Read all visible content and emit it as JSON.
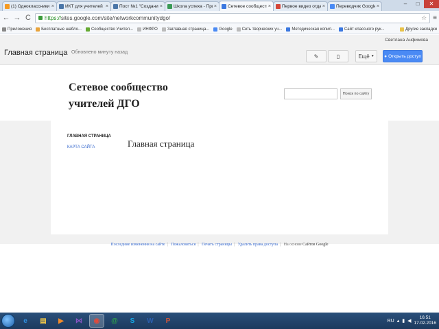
{
  "browser": {
    "tabs": [
      {
        "title": "(1) Одноклассники",
        "icon": "ok-favicon",
        "color": "#f59a23"
      },
      {
        "title": "ИКТ для учителей 2",
        "icon": "vk-favicon",
        "color": "#4a76a8"
      },
      {
        "title": "Пост №1 \"Создание",
        "icon": "vk-favicon",
        "color": "#4a76a8"
      },
      {
        "title": "Школа успеха - Прил",
        "icon": "sites-favicon",
        "color": "#3a9a56"
      },
      {
        "title": "Сетевое сообщество",
        "icon": "sites-favicon",
        "color": "#3b78e0",
        "active": true
      },
      {
        "title": "Первое видео отдания",
        "icon": "gmail-favicon",
        "color": "#d44638"
      },
      {
        "title": "Переводчик Google",
        "icon": "translate-favicon",
        "color": "#4a8af4"
      }
    ],
    "url_scheme": "https://",
    "url_rest": "sites.google.com/site/networkcommunitydgo/",
    "bookmarks": [
      {
        "label": "Приложения",
        "icon": "apps-icon",
        "color": "#888"
      },
      {
        "label": "Бесплатные шабло...",
        "icon": "bookmark-icon",
        "color": "#e8a33b"
      },
      {
        "label": "Сообщество Учител...",
        "icon": "bookmark-icon",
        "color": "#66aa33"
      },
      {
        "label": "ИНФРО",
        "icon": "page-icon",
        "color": "#bbb"
      },
      {
        "label": "Заглавная страница...",
        "icon": "page-icon",
        "color": "#bbb"
      },
      {
        "label": "Google",
        "icon": "google-icon",
        "color": "#4a8af4"
      },
      {
        "label": "Сеть творческих уч...",
        "icon": "page-icon",
        "color": "#bbb"
      },
      {
        "label": "Методическая копил...",
        "icon": "bookmark-icon",
        "color": "#3b78e0"
      },
      {
        "label": "Сайт классного рук...",
        "icon": "bookmark-icon",
        "color": "#3b78e0"
      }
    ],
    "other_bookmarks": "Другие закладки"
  },
  "sites_bar": {
    "user": "Светлана Анфимова",
    "site_name": "Главная страница",
    "subtitle": "Обновлено минуту назад",
    "edit_icon": "pencil-icon",
    "new_page_icon": "new-page-icon",
    "more_label": "Ещё",
    "share_label": "Открыть доступ"
  },
  "site": {
    "title_line1": "Сетевое сообщество",
    "title_line2": "учителей ДГО",
    "search_button": "Поиск по сайту",
    "nav_heading": "ГЛАВНАЯ СТРАНИЦА",
    "nav_link": "КАРТА САЙТА",
    "content_title": "Главная страница"
  },
  "footer": {
    "links": [
      "Последние изменения на сайте",
      "Пожаловаться",
      "Печать страницы",
      "Удалить права доступа"
    ],
    "powered_by": "На основе",
    "powered_name": "Сайтов Google"
  },
  "taskbar": {
    "apps": [
      {
        "name": "ie-icon",
        "glyph": "e",
        "color": "#2f8fe0"
      },
      {
        "name": "explorer-icon",
        "glyph": "▤",
        "color": "#e8c24a"
      },
      {
        "name": "media-player-icon",
        "glyph": "▶",
        "color": "#ef8a2a"
      },
      {
        "name": "visual-studio-icon",
        "glyph": "⋈",
        "color": "#8a55c4"
      },
      {
        "name": "chrome-icon",
        "glyph": "◉",
        "color": "#e24a3b",
        "active": true
      },
      {
        "name": "chrome-alt-icon",
        "glyph": "@",
        "color": "#2fa04a"
      },
      {
        "name": "skype-icon",
        "glyph": "S",
        "color": "#16a8e6"
      },
      {
        "name": "word-icon",
        "glyph": "W",
        "color": "#2b5fb0"
      },
      {
        "name": "powerpoint-icon",
        "glyph": "P",
        "color": "#d0563a"
      }
    ],
    "lang": "RU",
    "time": "16:51",
    "date": "17.02.2016"
  },
  "colors": {
    "accent_blue": "#4a8af4",
    "link_blue": "#3366cc",
    "band_gray": "#f1f1f1"
  }
}
